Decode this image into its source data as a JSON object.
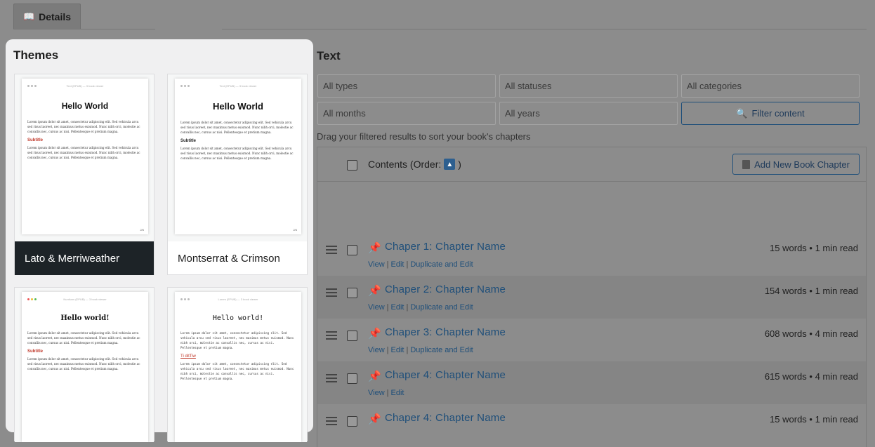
{
  "header": {
    "details_tab": "Details",
    "details_icon": "book-icon"
  },
  "themes": {
    "title": "Themes",
    "cards": [
      {
        "name": "Lato & Merriweather",
        "selected": true,
        "preview_title": "Hello World",
        "preview_subtitle": "Subtitle"
      },
      {
        "name": "Montserrat & Crimson",
        "selected": false,
        "preview_title": "Hello World",
        "preview_subtitle": "Subtitle"
      },
      {
        "name": "",
        "selected": false,
        "preview_title": "Hello world!",
        "preview_subtitle": "Subtitle"
      },
      {
        "name": "",
        "selected": false,
        "preview_title": "Hello world!",
        "preview_subtitle": "Ti ditTiw"
      }
    ],
    "lorem": "Lorem ipsum dolor sit amet, consectetur adipiscing elit. Sed vehicula arcu sed risus laoreet, nec maximus metus euismod. Nunc nibh orci, molestie ac convallis nec, cursus ac nisi. Pellentesque et pretium magna."
  },
  "text_panel": {
    "title": "Text",
    "filters": {
      "types": "All types",
      "statuses": "All statuses",
      "categories": "All categories",
      "months": "All months",
      "years": "All years",
      "filter_button": "Filter content"
    },
    "hint": "Drag your filtered results to sort your book's chapters",
    "table": {
      "contents_label": "Contents (Order:",
      "contents_close": ")",
      "add_button": "Add New Book Chapter"
    },
    "chapters": [
      {
        "title": "Chaper 1: Chapter Name",
        "meta": "15 words • 1 min read",
        "actions": [
          "View",
          "Edit",
          "Duplicate and Edit"
        ]
      },
      {
        "title": "Chaper 2: Chapter Name",
        "meta": "154 words • 1 min read",
        "actions": [
          "View",
          "Edit",
          "Duplicate and Edit"
        ]
      },
      {
        "title": "Chaper 3: Chapter Name",
        "meta": "608 words • 4 min read",
        "actions": [
          "View",
          "Edit",
          "Duplicate and Edit"
        ]
      },
      {
        "title": "Chaper 4: Chapter Name",
        "meta": "615 words • 4 min read",
        "actions": [
          "View",
          "Edit"
        ]
      },
      {
        "title": "Chaper 4: Chapter Name",
        "meta": "15 words • 1 min read",
        "actions": []
      }
    ]
  }
}
